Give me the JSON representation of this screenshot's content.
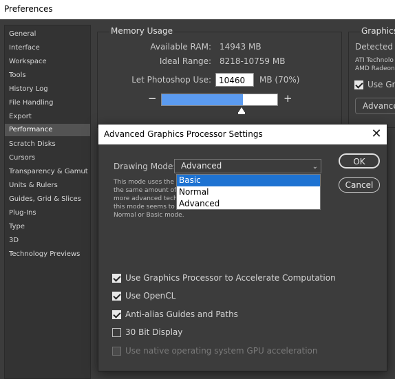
{
  "window": {
    "title": "Preferences"
  },
  "sidebar": {
    "items": [
      {
        "label": "General"
      },
      {
        "label": "Interface"
      },
      {
        "label": "Workspace"
      },
      {
        "label": "Tools"
      },
      {
        "label": "History Log"
      },
      {
        "label": "File Handling"
      },
      {
        "label": "Export"
      },
      {
        "label": "Performance",
        "selected": true
      },
      {
        "label": "Scratch Disks"
      },
      {
        "label": "Cursors"
      },
      {
        "label": "Transparency & Gamut"
      },
      {
        "label": "Units & Rulers"
      },
      {
        "label": "Guides, Grid & Slices"
      },
      {
        "label": "Plug-Ins"
      },
      {
        "label": "Type"
      },
      {
        "label": "3D"
      },
      {
        "label": "Technology Previews"
      }
    ]
  },
  "memory": {
    "title": "Memory Usage",
    "available_label": "Available RAM:",
    "available_value": "14943 MB",
    "ideal_label": "Ideal Range:",
    "ideal_value": "8218-10759 MB",
    "let_label": "Let Photoshop Use:",
    "let_value": "10460",
    "let_unit": "MB (70%)",
    "percent": 70,
    "minus": "−",
    "plus": "+"
  },
  "graphics": {
    "title": "Graphics",
    "detected": "Detected G",
    "gpu_line1": "ATI Technolo",
    "gpu_line2": "AMD Radeon",
    "use_gpu_label": "Use Gra",
    "advanced_button": "Advance"
  },
  "dialog": {
    "title": "Advanced Graphics Processor Settings",
    "close": "✕",
    "drawing_mode_label": "Drawing Mode:",
    "drawing_mode_value": "Advanced",
    "description": "This mode uses the ... the same amount of ... more advanced tech... this mode seems to ... Normal or Basic mode.",
    "desc_lines": [
      "This mode uses the",
      "the same amount of",
      "more advanced tech",
      "this mode seems to",
      "Normal or Basic mode."
    ],
    "options": [
      {
        "label": "Basic",
        "highlighted": true
      },
      {
        "label": "Normal",
        "highlighted": false
      },
      {
        "label": "Advanced",
        "highlighted": false
      }
    ],
    "ok_label": "OK",
    "cancel_label": "Cancel",
    "checkboxes": [
      {
        "label": "Use Graphics Processor to Accelerate Computation",
        "checked": true,
        "enabled": true
      },
      {
        "label": "Use OpenCL",
        "checked": true,
        "enabled": true
      },
      {
        "label": "Anti-alias Guides and Paths",
        "checked": true,
        "enabled": true
      },
      {
        "label": "30 Bit Display",
        "checked": false,
        "enabled": true
      },
      {
        "label": "Use native operating system GPU acceleration",
        "checked": false,
        "enabled": false
      }
    ]
  }
}
